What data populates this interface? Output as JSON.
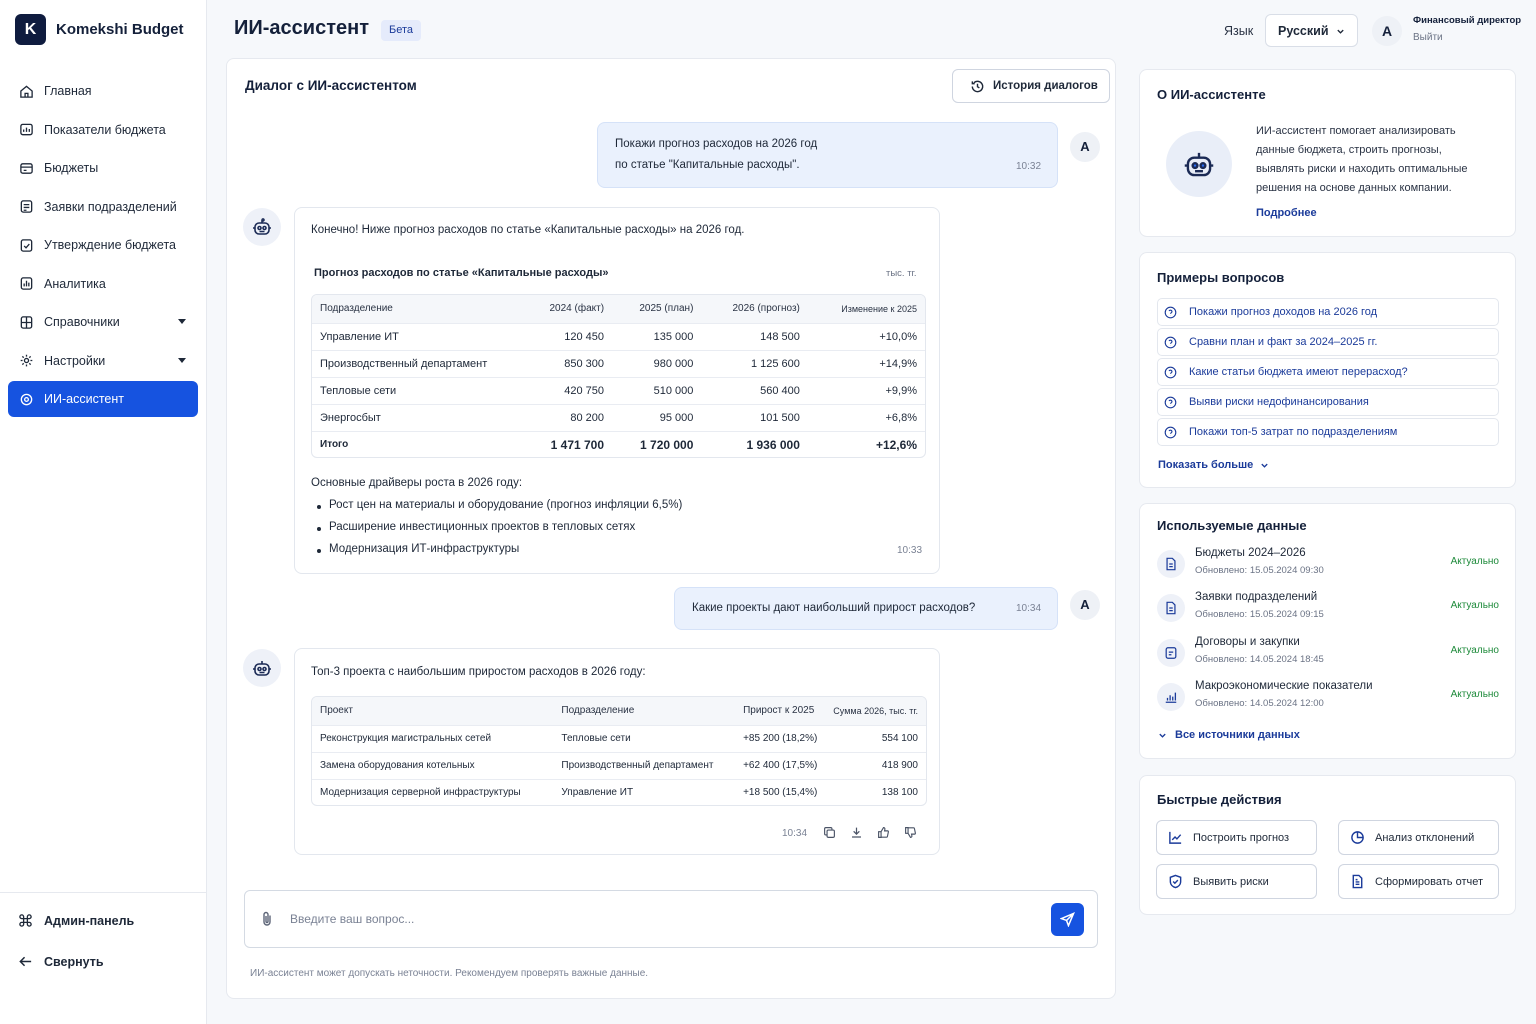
{
  "app": {
    "logo_letter": "K",
    "name": "Komekshi Budget"
  },
  "sidebar": {
    "items": [
      {
        "label": "Главная",
        "icon": "home-icon"
      },
      {
        "label": "Показатели бюджета",
        "icon": "dashboard-icon"
      },
      {
        "label": "Бюджеты",
        "icon": "wallet-icon"
      },
      {
        "label": "Заявки подразделений",
        "icon": "requests-icon"
      },
      {
        "label": "Утверждение бюджета",
        "icon": "approve-icon"
      },
      {
        "label": "Аналитика",
        "icon": "analytics-icon"
      },
      {
        "label": "Справочники",
        "icon": "book-icon",
        "has_caret": true
      },
      {
        "label": "Настройки",
        "icon": "gear-icon",
        "has_caret": true
      },
      {
        "label": "ИИ-ассистент",
        "icon": "ai-icon",
        "active": true
      }
    ],
    "admin": "Админ-панель",
    "collapse": "Свернуть"
  },
  "header": {
    "title": "ИИ-ассистент",
    "badge": "Бета",
    "lang_label": "Язык",
    "lang_value": "Русский",
    "avatar": "А",
    "role": "Финансовый директор",
    "logout": "Выйти"
  },
  "chat": {
    "title": "Диалог с ИИ-ассистентом",
    "history_button": "История диалогов",
    "user_avatar": "А",
    "msg1": {
      "line1": "Покажи прогноз расходов на 2026 год",
      "line2": "по статье \"Капитальные расходы\".",
      "time": "10:32"
    },
    "msg2": {
      "intro": "Конечно! Ниже прогноз расходов по статье «Капитальные расходы» на 2026 год.",
      "table_title": "Прогноз расходов по статье «Капитальные расходы»",
      "unit": "тыс. тг.",
      "headers": [
        "Подразделение",
        "2024 (факт)",
        "2025 (план)",
        "2026 (прогноз)",
        "Изменение к 2025"
      ],
      "rows": [
        [
          "Управление ИТ",
          "120 450",
          "135 000",
          "148 500",
          "+10,0%"
        ],
        [
          "Производственный департамент",
          "850 300",
          "980 000",
          "1 125 600",
          "+14,9%"
        ],
        [
          "Тепловые сети",
          "420 750",
          "510 000",
          "560 400",
          "+9,9%"
        ],
        [
          "Энергосбыт",
          "80 200",
          "95 000",
          "101 500",
          "+6,8%"
        ]
      ],
      "total": [
        "Итого",
        "1 471 700",
        "1 720 000",
        "1 936 000",
        "+12,6%"
      ],
      "drivers_title": "Основные драйверы роста в 2026 году:",
      "drivers": [
        "Рост цен на материалы и оборудование (прогноз инфляции 6,5%)",
        "Расширение инвестиционных проектов в тепловых сетях",
        "Модернизация ИТ-инфраструктуры"
      ],
      "time": "10:33"
    },
    "msg3": {
      "text": "Какие проекты дают наибольший прирост расходов?",
      "time": "10:34"
    },
    "msg4": {
      "intro": "Топ-3 проекта с наибольшим приростом расходов в 2026 году:",
      "headers": [
        "Проект",
        "Подразделение",
        "Прирост к 2025",
        "Сумма 2026, тыс. тг."
      ],
      "rows": [
        [
          "Реконструкция магистральных сетей",
          "Тепловые сети",
          "+85 200 (18,2%)",
          "554 100"
        ],
        [
          "Замена оборудования котельных",
          "Производственный департамент",
          "+62 400 (17,5%)",
          "418 900"
        ],
        [
          "Модернизация серверной инфраструктуры",
          "Управление ИТ",
          "+18 500 (15,4%)",
          "138 100"
        ]
      ],
      "time": "10:34"
    },
    "input_placeholder": "Введите ваш вопрос...",
    "disclaimer": "ИИ-ассистент может допускать неточности. Рекомендуем проверять важные данные."
  },
  "about": {
    "title": "О ИИ-ассистенте",
    "lines": [
      "ИИ-ассистент помогает анализировать",
      "данные бюджета, строить прогнозы,",
      "выявлять риски и находить оптимальные",
      "решения на основе данных компании."
    ],
    "more": "Подробнее"
  },
  "examples": {
    "title": "Примеры вопросов",
    "items": [
      "Покажи прогноз доходов на 2026 год",
      "Сравни план и факт за 2024–2025 гг.",
      "Какие статьи бюджета имеют перерасход?",
      "Выяви риски недофинансирования",
      "Покажи топ-5 затрат по подразделениям"
    ],
    "show_more": "Показать больше"
  },
  "data_sources": {
    "title": "Используемые данные",
    "items": [
      {
        "name": "Бюджеты 2024–2026",
        "updated": "Обновлено: 15.05.2024 09:30",
        "status": "Актуально"
      },
      {
        "name": "Заявки подразделений",
        "updated": "Обновлено: 15.05.2024 09:15",
        "status": "Актуально"
      },
      {
        "name": "Договоры и закупки",
        "updated": "Обновлено: 14.05.2024 18:45",
        "status": "Актуально"
      },
      {
        "name": "Макроэкономические показатели",
        "updated": "Обновлено: 14.05.2024 12:00",
        "status": "Актуально"
      }
    ],
    "all": "Все источники данных"
  },
  "quick": {
    "title": "Быстрые действия",
    "items": [
      "Построить прогноз",
      "Анализ отклонений",
      "Выявить риски",
      "Сформировать отчет"
    ]
  },
  "colors": {
    "accent": "#1653e0",
    "positive": "#1d8a3a",
    "link": "#1b3b9a"
  }
}
